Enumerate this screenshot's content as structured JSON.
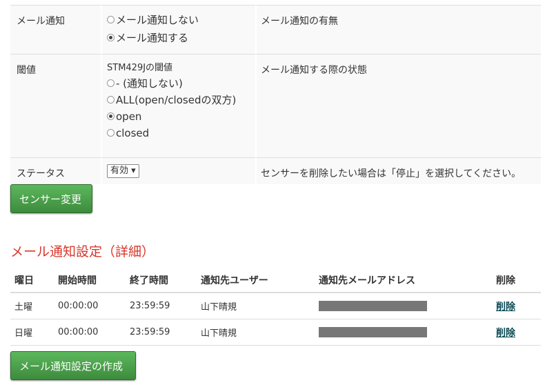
{
  "settings": {
    "mail": {
      "label": "メール通知",
      "options": [
        "メール通知しない",
        "メール通知する"
      ],
      "selected_index": 1,
      "description": "メール通知の有無"
    },
    "threshold": {
      "label": "閾値",
      "sublabel": "STM429Jの閾値",
      "options": [
        "- (通知しない)",
        "ALL(open/closedの双方)",
        "open",
        "closed"
      ],
      "selected_index": 2,
      "description": "メール通知する際の状態"
    },
    "status": {
      "label": "ステータス",
      "select_value": "有効 ▾",
      "description": "センサーを削除したい場合は「停止」を選択してください。"
    }
  },
  "update_button": "センサー変更",
  "detail_title": "メール通知設定（詳細）",
  "table": {
    "headers": [
      "曜日",
      "開始時間",
      "終了時間",
      "通知先ユーザー",
      "通知先メールアドレス",
      "削除"
    ],
    "rows": [
      {
        "day": "土曜",
        "start": "00:00:00",
        "end": "23:59:59",
        "user": "山下晴規",
        "delete": "削除"
      },
      {
        "day": "日曜",
        "start": "00:00:00",
        "end": "23:59:59",
        "user": "山下晴規",
        "delete": "削除"
      }
    ]
  },
  "create_button": "メール通知設定の作成"
}
